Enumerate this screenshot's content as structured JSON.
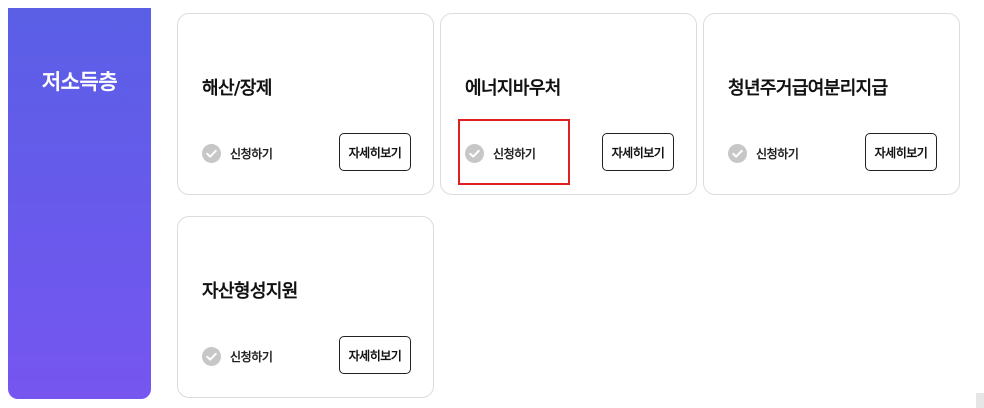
{
  "category": {
    "title": "저소득층"
  },
  "cards": [
    {
      "title": "해산/장제",
      "apply_label": "신청하기",
      "detail_label": "자세히보기"
    },
    {
      "title": "에너지바우처",
      "apply_label": "신청하기",
      "detail_label": "자세히보기"
    },
    {
      "title": "청년주거급여분리지급",
      "apply_label": "신청하기",
      "detail_label": "자세히보기"
    },
    {
      "title": "자산형성지원",
      "apply_label": "신청하기",
      "detail_label": "자세히보기"
    }
  ],
  "icons": {
    "apply": "check-circle-icon"
  },
  "colors": {
    "category_gradient_start": "#5a5fe6",
    "category_gradient_end": "#7656ef",
    "check_icon": "#c7c7c7",
    "highlight": "#e02020",
    "card_border": "#dcdcdc"
  }
}
